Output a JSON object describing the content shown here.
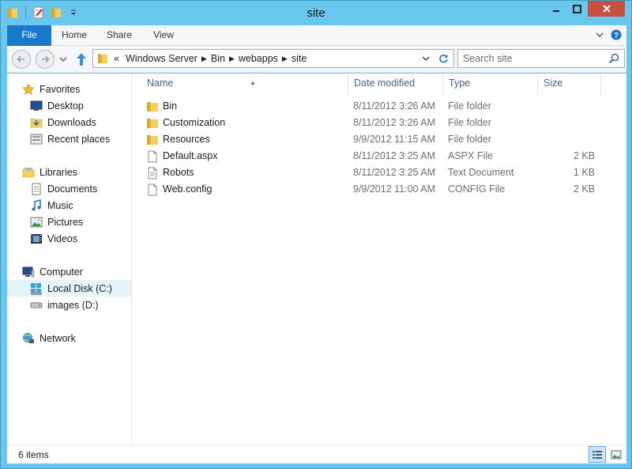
{
  "window": {
    "title": "site",
    "controls": [
      "minimize",
      "maximize",
      "close"
    ]
  },
  "quick_access_toolbar": {
    "icons": [
      "folder-icon",
      "properties-icon",
      "new-folder-icon",
      "customize-dropdown-icon"
    ]
  },
  "ribbon": {
    "tabs": [
      {
        "label": "File",
        "active": true
      },
      {
        "label": "Home"
      },
      {
        "label": "Share"
      },
      {
        "label": "View"
      }
    ]
  },
  "address": {
    "overflow": "«",
    "crumbs": [
      "Windows Server",
      "Bin",
      "webapps",
      "site"
    ]
  },
  "search": {
    "placeholder": "Search site"
  },
  "navigation": {
    "favorites": {
      "label": "Favorites",
      "items": [
        "Desktop",
        "Downloads",
        "Recent places"
      ]
    },
    "libraries": {
      "label": "Libraries",
      "items": [
        "Documents",
        "Music",
        "Pictures",
        "Videos"
      ]
    },
    "computer": {
      "label": "Computer",
      "items": [
        "Local Disk (C:)",
        "images (D:)"
      ],
      "selected": "Local Disk (C:)"
    },
    "network": {
      "label": "Network"
    }
  },
  "columns": {
    "name": "Name",
    "date": "Date modified",
    "type": "Type",
    "size": "Size"
  },
  "files": [
    {
      "name": "Bin",
      "date": "8/11/2012 3:26 AM",
      "type": "File folder",
      "size": "",
      "icon": "folder"
    },
    {
      "name": "Customization",
      "date": "8/11/2012 3:26 AM",
      "type": "File folder",
      "size": "",
      "icon": "folder"
    },
    {
      "name": "Resources",
      "date": "9/9/2012 11:15 AM",
      "type": "File folder",
      "size": "",
      "icon": "folder"
    },
    {
      "name": "Default.aspx",
      "date": "8/11/2012 3:25 AM",
      "type": "ASPX File",
      "size": "2 KB",
      "icon": "file"
    },
    {
      "name": "Robots",
      "date": "8/11/2012 3:25 AM",
      "type": "Text Document",
      "size": "1 KB",
      "icon": "text-file"
    },
    {
      "name": "Web.config",
      "date": "9/9/2012 11:00 AM",
      "type": "CONFIG File",
      "size": "2 KB",
      "icon": "file"
    }
  ],
  "status": {
    "item_count": "6 items"
  },
  "colors": {
    "titlebar": "#69c6ec",
    "file_tab": "#1979ca",
    "close_button": "#c7503f",
    "selection": "#e5f3fb",
    "column_header_text": "#4c607a"
  }
}
